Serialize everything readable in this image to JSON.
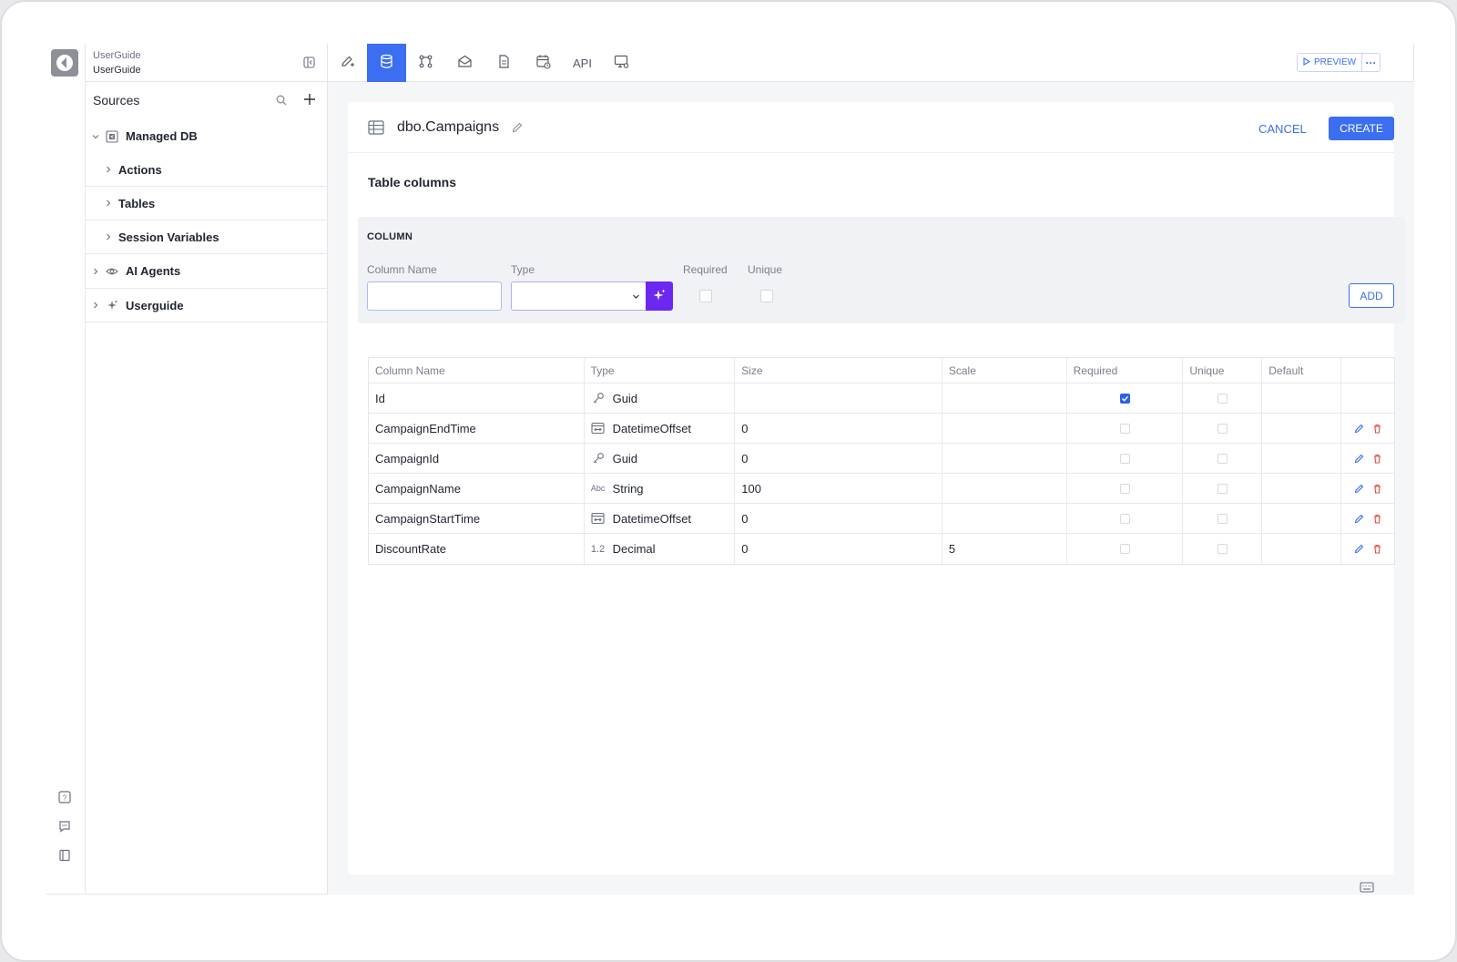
{
  "workspace": {
    "name": "UserGuide",
    "subtitle": "UserGuide"
  },
  "sidebar": {
    "title": "Sources",
    "tree": {
      "managed_db": "Managed DB",
      "actions": "Actions",
      "tables": "Tables",
      "session_variables": "Session Variables",
      "ai_agents": "AI Agents",
      "userguide": "Userguide"
    }
  },
  "toolbar": {
    "api_label": "API",
    "preview_label": "PREVIEW",
    "more_label": "···",
    "active_tab": "database"
  },
  "editor": {
    "table_name": "dbo.Campaigns",
    "cancel_label": "CANCEL",
    "create_label": "CREATE",
    "section_title": "Table columns"
  },
  "column_form": {
    "title": "COLUMN",
    "name_label": "Column Name",
    "name_value": "",
    "type_label": "Type",
    "type_value": "",
    "required_label": "Required",
    "unique_label": "Unique",
    "add_label": "ADD"
  },
  "columns_table": {
    "headers": [
      "Column Name",
      "Type",
      "Size",
      "Scale",
      "Required",
      "Unique",
      "Default"
    ],
    "rows": [
      {
        "name": "Id",
        "type": "Guid",
        "type_icon": "key-icon",
        "size": "",
        "scale": "",
        "required": true,
        "unique": false,
        "default": "",
        "editable": false
      },
      {
        "name": "CampaignEndTime",
        "type": "DatetimeOffset",
        "type_icon": "calendar-range-icon",
        "size": "0",
        "scale": "",
        "required": false,
        "unique": false,
        "default": "",
        "editable": true
      },
      {
        "name": "CampaignId",
        "type": "Guid",
        "type_icon": "key-icon",
        "size": "0",
        "scale": "",
        "required": false,
        "unique": false,
        "default": "",
        "editable": true
      },
      {
        "name": "CampaignName",
        "type": "String",
        "type_icon": "abc-icon",
        "size": "100",
        "scale": "",
        "required": false,
        "unique": false,
        "default": "",
        "editable": true
      },
      {
        "name": "CampaignStartTime",
        "type": "DatetimeOffset",
        "type_icon": "calendar-range-icon",
        "size": "0",
        "scale": "",
        "required": false,
        "unique": false,
        "default": "",
        "editable": true
      },
      {
        "name": "DiscountRate",
        "type": "Decimal",
        "type_icon": "decimal-icon",
        "size": "0",
        "scale": "5",
        "required": false,
        "unique": false,
        "default": "",
        "editable": true
      }
    ]
  },
  "icons": {
    "abc_glyph": "Abc",
    "decimal_glyph": "1.2"
  },
  "colors": {
    "accent": "#3b6ef0",
    "ai_accent": "#6c28f0",
    "delete": "#e5483c"
  }
}
